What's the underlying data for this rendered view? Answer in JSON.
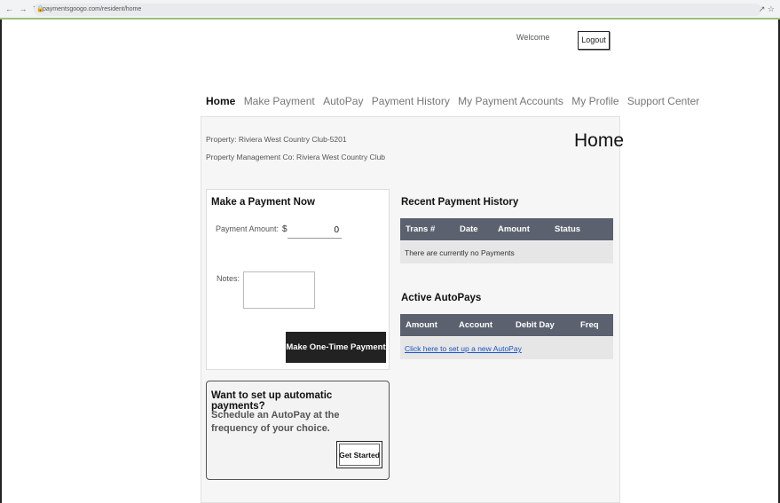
{
  "browser": {
    "nav_glyphs": "← → ↻",
    "lock_glyph": "🔒",
    "url": "paymentsgoogo.com/resident/home",
    "controls": "↗ ☆"
  },
  "header": {
    "welcome": "Welcome",
    "logout_label": "Logout"
  },
  "nav": {
    "items": [
      {
        "label": "Home"
      },
      {
        "label": "Make Payment"
      },
      {
        "label": "AutoPay"
      },
      {
        "label": "Payment History"
      },
      {
        "label": "My Payment Accounts"
      },
      {
        "label": "My Profile"
      },
      {
        "label": "Support Center"
      }
    ]
  },
  "property": {
    "line1": "Property:  Riviera West Country Club-5201",
    "line2": "Property Management Co:  Riviera West Country Club"
  },
  "page_title": "Home",
  "make_payment": {
    "title": "Make a Payment Now",
    "amount_label": "Payment Amount:",
    "currency": "$",
    "amount_value": "0",
    "notes_label": "Notes:",
    "notes_value": "",
    "submit_label": "Make One-Time Payment"
  },
  "autopay_promo": {
    "question": "Want to set up automatic payments?",
    "subtitle": "Schedule an AutoPay at the frequency of your choice.",
    "button_label": "Get Started"
  },
  "recent_history": {
    "title": "Recent Payment History",
    "columns": [
      "Trans #",
      "Date",
      "Amount",
      "Status"
    ],
    "empty_message": "There are currently no Payments"
  },
  "active_autopays": {
    "title": "Active AutoPays",
    "columns": [
      "Amount",
      "Account",
      "Debit Day",
      "Freq"
    ],
    "setup_link": "Click here to set up a new AutoPay"
  },
  "colors": {
    "table_header": "#5c6170",
    "primary_button": "#222222",
    "link": "#1a56c4"
  }
}
